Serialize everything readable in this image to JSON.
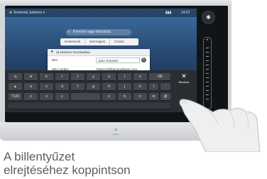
{
  "status_bar": {
    "left_text": "⊕ Territorial Jukebox ▾",
    "battery_text": "▮▮▮",
    "time": "14:07"
  },
  "search": {
    "placeholder": "Keresés vagy tárcsázás"
  },
  "tabs": [
    "Kedvencek",
    "Nemrégiek",
    "Címtár"
  ],
  "dialog": {
    "title": "Új kedvenc hozzáadása",
    "name_label": "Név",
    "name_value": "Jane Granster",
    "uri_label": "URI / Szám",
    "uri_value": "7046170@barntoolbeep.com"
  },
  "keyboard": {
    "row1": [
      "q",
      "w",
      "e",
      "r",
      "t",
      "y",
      "u",
      "i",
      "o",
      "p"
    ],
    "row2": [
      "a",
      "s",
      "d",
      "f",
      "g",
      "h",
      "j",
      "k",
      "l",
      "'"
    ],
    "row3": [
      "z",
      "x",
      "c",
      "v",
      "b",
      "n",
      "m"
    ],
    "shift": "▲",
    "backspace": "⌫",
    "numbers": "?123",
    "at": "@",
    "close_label": "Bezárás",
    "close_glyph": "✕"
  },
  "side_icons": {
    "top": "✱",
    "plus": "+"
  },
  "brand": {
    "logo_text": "cisco",
    "logo_bars": "ıılıı"
  },
  "caption_line1": "A billentyűzet",
  "caption_line2": "elrejtéséhez koppintson"
}
